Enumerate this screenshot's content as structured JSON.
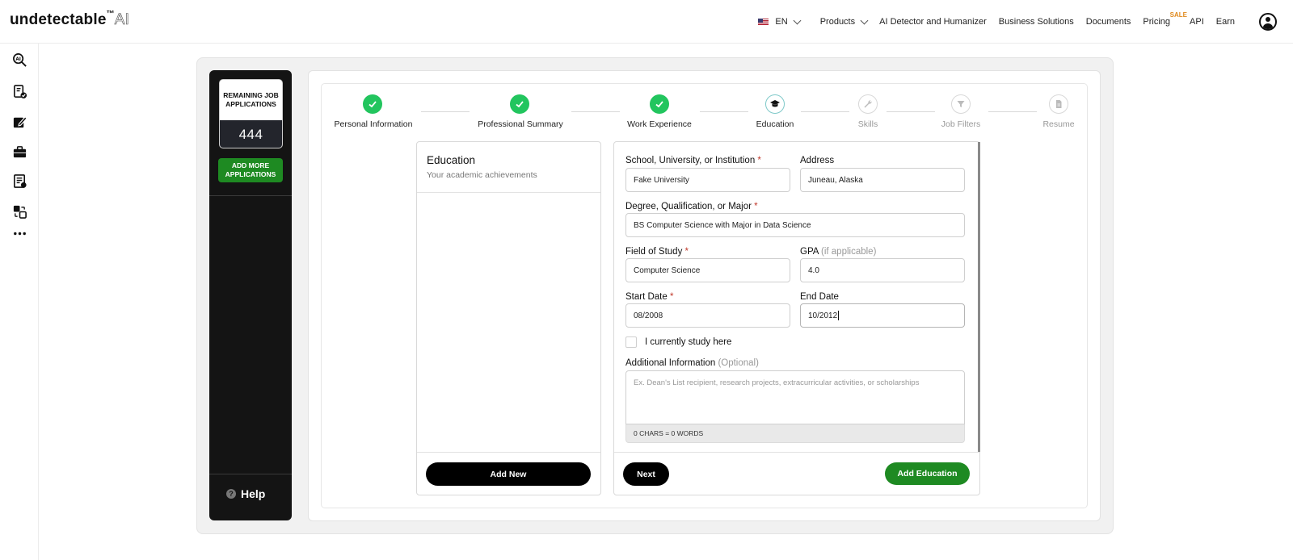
{
  "brand": {
    "name": "undetectable",
    "tm": "™",
    "ai": "AI"
  },
  "nav": {
    "language": "EN",
    "products": "Products",
    "detector": "AI Detector and Humanizer",
    "business": "Business Solutions",
    "documents": "Documents",
    "pricing": "Pricing",
    "sale_badge": "SALE",
    "api": "API",
    "earn": "Earn"
  },
  "rail_icons": [
    "ai-search-icon",
    "document-check-icon",
    "edit-icon",
    "briefcase-icon",
    "id-card-icon",
    "translate-icon",
    "more-icon"
  ],
  "sidebar": {
    "remaining_label": "REMAINING JOB APPLICATIONS",
    "remaining_count": "444",
    "add_more": "ADD MORE APPLICATIONS",
    "help": "Help"
  },
  "stepper": {
    "steps": [
      {
        "label": "Personal Information",
        "status": "done"
      },
      {
        "label": "Professional Summary",
        "status": "done"
      },
      {
        "label": "Work Experience",
        "status": "done"
      },
      {
        "label": "Education",
        "status": "current"
      },
      {
        "label": "Skills",
        "status": "todo"
      },
      {
        "label": "Job Filters",
        "status": "todo"
      },
      {
        "label": "Resume",
        "status": "todo"
      }
    ]
  },
  "list_panel": {
    "title": "Education",
    "subtitle": "Your academic achievements",
    "add_new": "Add New"
  },
  "form": {
    "school_label": "School, University, or Institution",
    "school_value": "Fake University",
    "address_label": "Address",
    "address_value": "Juneau, Alaska",
    "degree_label": "Degree, Qualification, or Major",
    "degree_value": "BS Computer Science with Major in Data Science",
    "field_label": "Field of Study",
    "field_value": "Computer Science",
    "gpa_label": "GPA",
    "gpa_hint": "(if applicable)",
    "gpa_value": "4.0",
    "start_label": "Start Date",
    "start_value": "08/2008",
    "end_label": "End Date",
    "end_value": "10/2012",
    "current_label": "I currently study here",
    "current_checked": false,
    "additional_label": "Additional Information",
    "additional_hint": "(Optional)",
    "additional_placeholder": "Ex. Dean's List recipient, research projects, extracurricular activities, or scholarships",
    "counter": "0 CHARS = 0 WORDS",
    "required_mark": "*",
    "next": "Next",
    "add_education": "Add Education"
  },
  "colors": {
    "accent_green": "#1e8a22",
    "step_done": "#22c55e",
    "dark_panel": "#141414"
  }
}
